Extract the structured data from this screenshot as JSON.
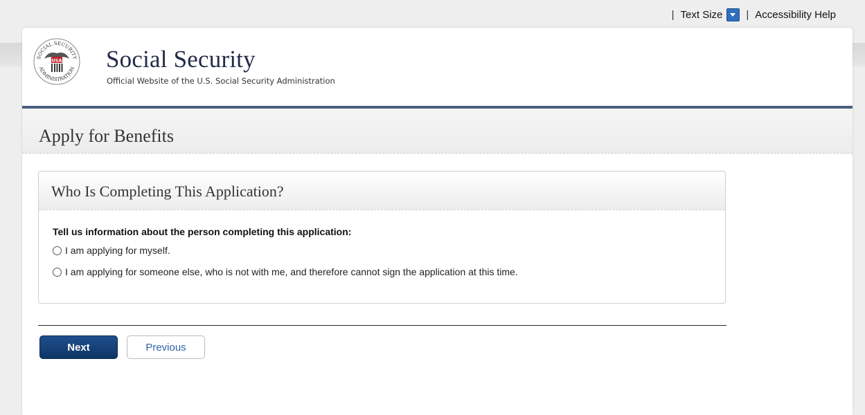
{
  "utility_bar": {
    "separator": "|",
    "text_size_label": "Text Size",
    "accessibility_label": "Accessibility Help"
  },
  "header": {
    "brand_title": "Social Security",
    "brand_subtitle": "Official Website of the U.S. Social Security Administration",
    "seal_text": {
      "top": "SOCIAL SECURITY",
      "bottom": "ADMINISTRATION",
      "center": "USA"
    }
  },
  "page": {
    "title": "Apply for Benefits"
  },
  "form": {
    "panel_title": "Who Is Completing This Application?",
    "question": "Tell us information about the person completing this application:",
    "options": [
      {
        "label": "I am applying for myself.",
        "selected": false
      },
      {
        "label": "I am applying for someone else, who is not with me, and therefore cannot sign the application at this time.",
        "selected": false
      }
    ]
  },
  "actions": {
    "next_label": "Next",
    "previous_label": "Previous"
  },
  "colors": {
    "header_rule": "#4a5d7e",
    "brand_navy": "#222b47",
    "next_button": "#1f4f8c",
    "previous_text": "#2d63a8"
  }
}
